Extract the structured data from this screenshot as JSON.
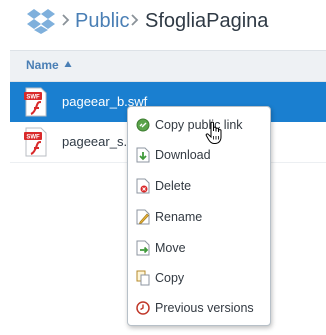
{
  "breadcrumb": {
    "items": [
      "Public",
      "SfogliaPagina"
    ]
  },
  "table": {
    "header": {
      "name_label": "Name"
    },
    "rows": [
      {
        "name": "pageear_b.swf",
        "selected": true,
        "icon": "swf-file-icon"
      },
      {
        "name": "pageear_s.sw",
        "selected": false,
        "icon": "swf-file-icon"
      }
    ]
  },
  "context_menu": {
    "items": [
      {
        "label": "Copy public link",
        "icon": "link-icon"
      },
      {
        "label": "Download",
        "icon": "download-icon"
      },
      {
        "label": "Delete",
        "icon": "delete-icon"
      },
      {
        "label": "Rename",
        "icon": "rename-icon"
      },
      {
        "label": "Move",
        "icon": "move-icon"
      },
      {
        "label": "Copy",
        "icon": "copy-icon"
      },
      {
        "label": "Previous versions",
        "icon": "previous-versions-icon"
      }
    ]
  },
  "colors": {
    "accent": "#4a7fb5",
    "selection": "#1a7fd0",
    "swf_red": "#d9292a"
  }
}
